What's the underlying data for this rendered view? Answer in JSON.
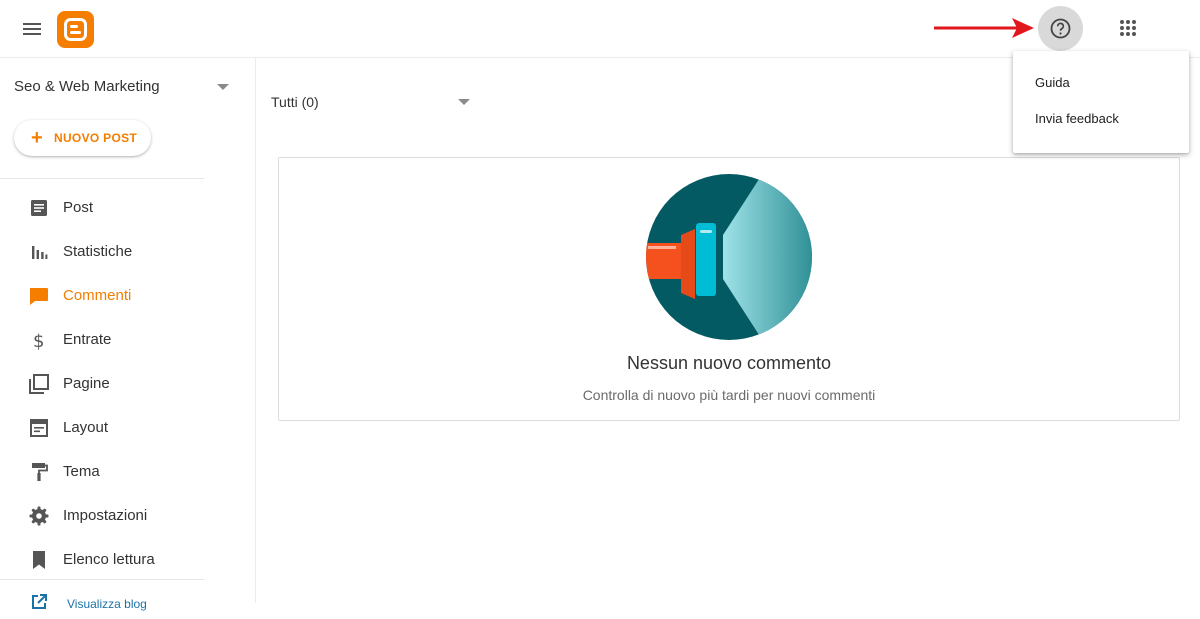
{
  "topbar": {
    "menu_icon": "hamburger-icon",
    "logo_icon": "blogger-logo-icon",
    "help_icon": "help-circle-icon",
    "apps_icon": "apps-grid-icon",
    "annotation": "red-arrow-icon"
  },
  "help_menu": {
    "items": [
      {
        "label": "Guida"
      },
      {
        "label": "Invia feedback"
      }
    ]
  },
  "sidebar": {
    "blog_name": "Seo & Web Marketing",
    "new_post_label": "NUOVO POST",
    "items": [
      {
        "label": "Post",
        "icon": "post-icon"
      },
      {
        "label": "Statistiche",
        "icon": "stats-icon"
      },
      {
        "label": "Commenti",
        "icon": "comment-icon",
        "active": true
      },
      {
        "label": "Entrate",
        "icon": "dollar-icon"
      },
      {
        "label": "Pagine",
        "icon": "pages-icon"
      },
      {
        "label": "Layout",
        "icon": "layout-icon"
      },
      {
        "label": "Tema",
        "icon": "paint-roller-icon"
      },
      {
        "label": "Impostazioni",
        "icon": "gear-icon"
      },
      {
        "label": "Elenco lettura",
        "icon": "bookmark-icon"
      }
    ],
    "view_blog_label": "Visualizza blog"
  },
  "main": {
    "filter_label": "Tutti (0)",
    "empty_title": "Nessun nuovo commento",
    "empty_subtitle": "Controlla di nuovo più tardi per nuovi commenti"
  },
  "colors": {
    "accent": "#f57d00",
    "illustration_dark": "#045a63",
    "illustration_light": "#7fd3d9",
    "illustration_red": "#f4511e",
    "illustration_cyan": "#00bcd4",
    "annotation_red": "#e0181e"
  }
}
